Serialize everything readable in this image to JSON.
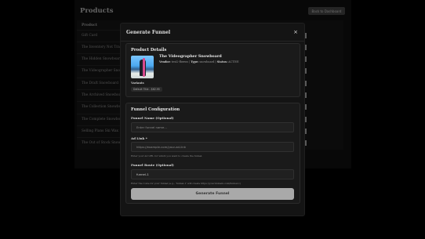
{
  "background": {
    "title": "Products",
    "back_button": "Back to Dashboard",
    "table_header": "Product",
    "rows": [
      "Gift Card",
      "The Inventory Not Tracked",
      "The Hidden Snowboard",
      "The Videographer Snowbo",
      "The Draft Snowboard",
      "The Archived Snowboard",
      "The Collection Snowboard",
      "The Complete Snowboard",
      "Selling Plans Ski Wax",
      "The Out of Stock Snowbo"
    ]
  },
  "modal": {
    "title": "Generate Funnel",
    "close": "×",
    "product_details": {
      "heading": "Product Details",
      "name": "The Videographer Snowboard",
      "vendor_label": "Vendor:",
      "vendor": "test2-fbrxws",
      "type_label": "Type:",
      "type": "snowboard",
      "status_label": "Status:",
      "status": "ACTIVE",
      "variants_label": "Variants",
      "variants": [
        "Default Title - $62.95"
      ]
    },
    "funnel_config": {
      "heading": "Funnel Configuration",
      "name_label": "Funnel Name (Optional)",
      "name_placeholder": "Enter funnel name...",
      "ad_link_label": "Ad Link *",
      "ad_link_placeholder": "https://example.com/your-ad-link",
      "ad_link_help": "Enter your Ad URL for which you want to create the funnel.",
      "route_label": "Funnel Route (Optional)",
      "route_value": "funnel-1",
      "route_help": "Enter the route for your funnel (e.g., 'funnel-1' will create https://yourdomain.com/funnel-1)",
      "submit_label": "Generate Funnel"
    }
  }
}
